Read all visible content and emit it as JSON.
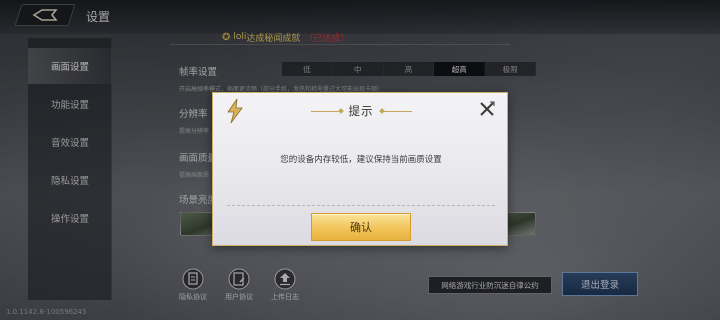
{
  "header": {
    "title": "设置",
    "achievement_text": "达成秘闻成就",
    "achievement_extra": "（已达成）",
    "achievement_prefix": "loli"
  },
  "sidebar": {
    "items": [
      {
        "label": "画面设置",
        "active": true
      },
      {
        "label": "功能设置",
        "active": false
      },
      {
        "label": "音效设置",
        "active": false
      },
      {
        "label": "隐私设置",
        "active": false
      },
      {
        "label": "操作设置",
        "active": false
      }
    ]
  },
  "settings": {
    "frame_rate": {
      "label": "帧率设置",
      "options": [
        "低",
        "中",
        "高",
        "超高",
        "极限"
      ],
      "selected": "超高",
      "desc": "开启高帧率模式，画面更流畅（部分手机，发热和耗电量过大可能出现卡顿）"
    },
    "resolution": {
      "label": "分辨率",
      "desc": "提高分辨率"
    },
    "quality": {
      "label": "画面质量",
      "desc": "提高画面质"
    },
    "scene": {
      "label": "场景亮度"
    }
  },
  "bottom": {
    "privacy": "隐私协议",
    "user": "用户协议",
    "upload": "上传日志",
    "policy_button": "网络游戏行业防沉迷自律公约",
    "logout_button": "退出登录",
    "version": "1.0.1142.8-100596245"
  },
  "dialog": {
    "title": "提示",
    "message": "您的设备内存较低，建议保持当前画质设置",
    "confirm": "确认"
  },
  "colors": {
    "accent_gold": "#f2c45a",
    "logout_blue": "#33527a",
    "alert_red": "#d73a3a"
  }
}
